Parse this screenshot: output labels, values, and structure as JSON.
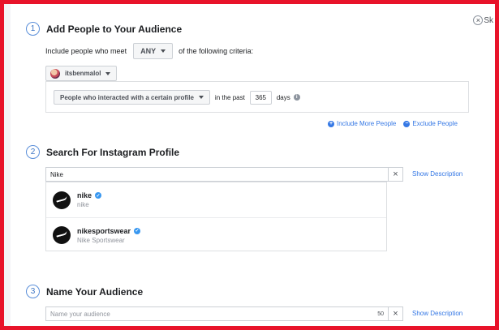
{
  "close": {
    "label": "Sk"
  },
  "step1": {
    "num": "1",
    "title": "Add People to Your Audience",
    "include_prefix": "Include people who meet",
    "match_value": "ANY",
    "include_suffix": "of the following criteria:",
    "account": "itsbenmalol",
    "criteria": {
      "type": "People who interacted with a certain profile",
      "in_past": "in the past",
      "days_value": "365",
      "days_label": "days"
    },
    "include_more": "Include More People",
    "exclude": "Exclude People"
  },
  "step2": {
    "num": "2",
    "title": "Search For Instagram Profile",
    "search_value": "Nike",
    "show_description": "Show Description",
    "results": [
      {
        "name": "nike",
        "sub": "nike"
      },
      {
        "name": "nikesportswear",
        "sub": "Nike Sportswear"
      }
    ]
  },
  "step3": {
    "num": "3",
    "title": "Name Your Audience",
    "placeholder": "Name your audience",
    "char_count": "50",
    "show_description": "Show Description"
  },
  "icons": {
    "clear": "×",
    "verified": "✓",
    "info": "i",
    "plus": "+",
    "minus": "−"
  }
}
